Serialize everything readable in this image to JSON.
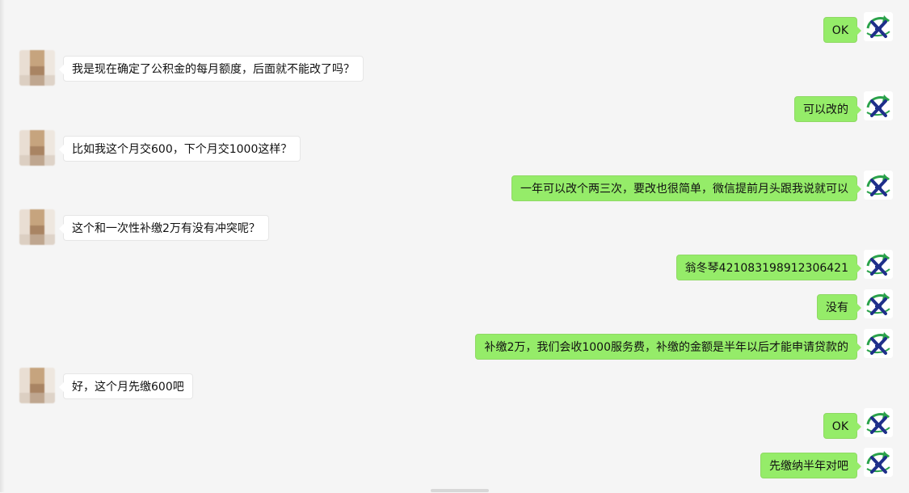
{
  "messages": [
    {
      "side": "out",
      "text": "OK"
    },
    {
      "side": "in",
      "text": "我是现在确定了公积金的每月额度，后面就不能改了吗？"
    },
    {
      "side": "out",
      "text": "可以改的"
    },
    {
      "side": "in",
      "text": "比如我这个月交600，下个月交1000这样？"
    },
    {
      "side": "out",
      "text": "一年可以改个两三次，要改也很简单，微信提前月头跟我说就可以"
    },
    {
      "side": "in",
      "text": "这个和一次性补缴2万有没有冲突呢？"
    },
    {
      "side": "out",
      "text": "翁冬琴421083198912306421"
    },
    {
      "side": "out",
      "text": "没有"
    },
    {
      "side": "out",
      "text": "补缴2万，我们会收1000服务费，补缴的金额是半年以后才能申请贷款的"
    },
    {
      "side": "in",
      "text": "好，这个月先缴600吧"
    },
    {
      "side": "out",
      "text": "OK"
    },
    {
      "side": "out",
      "text": "先缴纳半年对吧"
    }
  ],
  "colors": {
    "background": "#f5f5f5",
    "outgoing_bubble": "#95ec69",
    "incoming_bubble": "#ffffff",
    "logo_green": "#2aa24a",
    "logo_navy": "#1f2f8a"
  },
  "icons": {
    "outgoing_avatar": "company-logo-icon",
    "incoming_avatar": "blurred-user-avatar"
  }
}
